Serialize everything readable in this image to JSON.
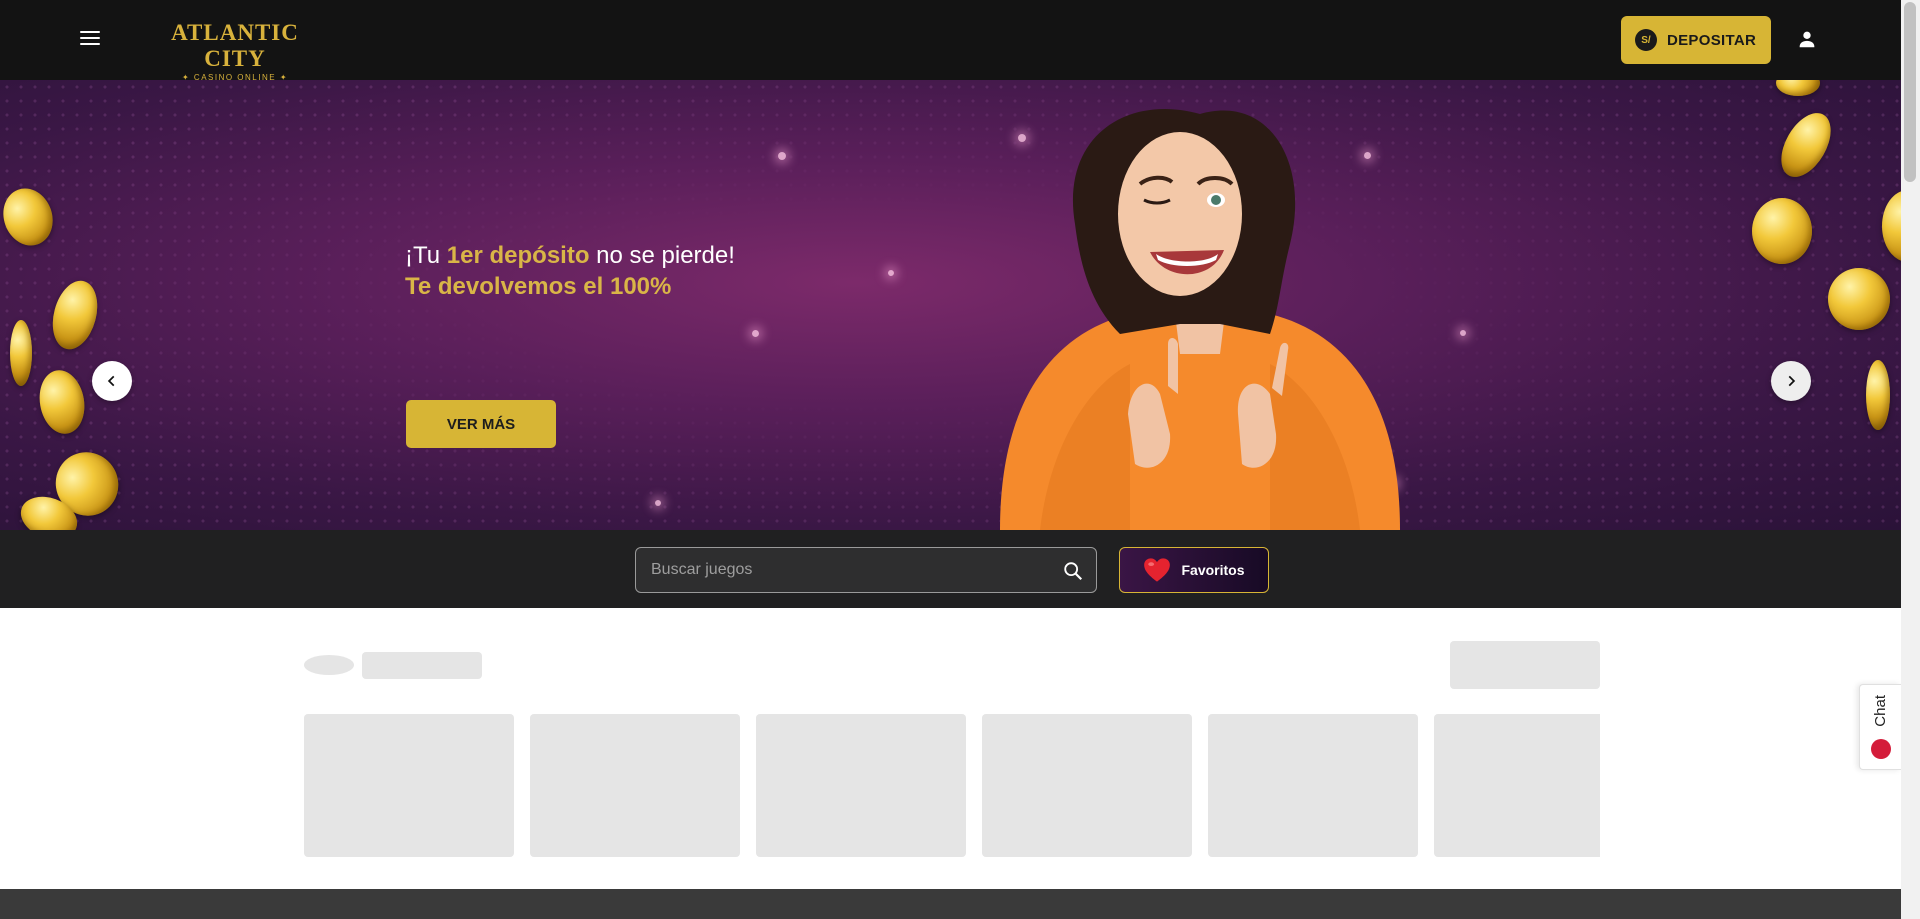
{
  "header": {
    "logo_main": "ATLANTIC CITY",
    "logo_sub": "✦ CASINO ONLINE ✦",
    "deposit_icon": "S/",
    "deposit_label": "DEPOSITAR",
    "icons": [
      "menu-icon",
      "user-icon"
    ]
  },
  "banner": {
    "line1_pre": "¡Tu ",
    "line1_highlight": "1er depósito",
    "line1_post": " no se pierde!",
    "line2": "Te devolvemos el 100%",
    "cta_label": "VER MÁS",
    "slide_count": 8,
    "active_slide": 1
  },
  "search": {
    "placeholder": "Buscar juegos",
    "favorites_label": "Favoritos"
  },
  "chat": {
    "label": "Chat"
  },
  "colors": {
    "header_bg": "#131313",
    "accent_gold": "#d7b535",
    "banner_purple": "#5a1f5a",
    "search_strip_bg": "#202021",
    "skeleton": "#e5e5e5"
  }
}
